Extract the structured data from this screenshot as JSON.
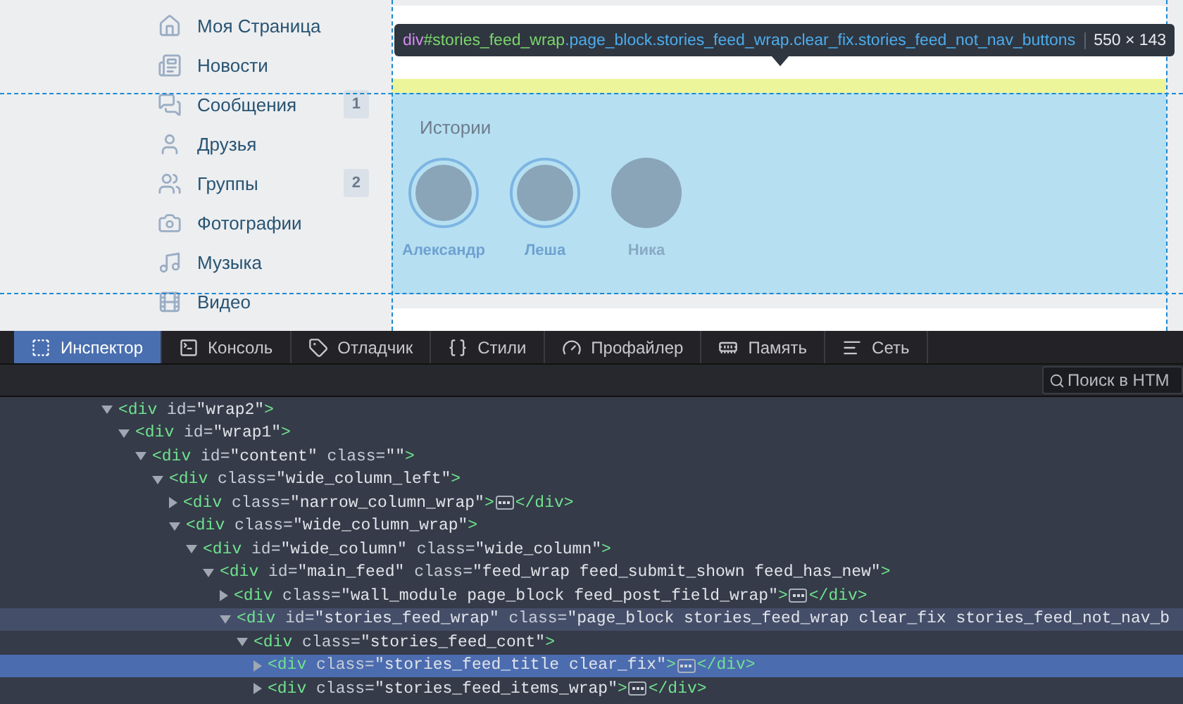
{
  "sidebar": {
    "items": [
      {
        "label": "Моя Страница"
      },
      {
        "label": "Новости"
      },
      {
        "label": "Сообщения",
        "counter": "1"
      },
      {
        "label": "Друзья"
      },
      {
        "label": "Группы",
        "counter": "2"
      },
      {
        "label": "Фотографии"
      },
      {
        "label": "Музыка"
      },
      {
        "label": "Видео"
      }
    ]
  },
  "tooltip": {
    "tag": "div",
    "id": "#stories_feed_wrap",
    "classes": ".page_block.stories_feed_wrap.clear_fix.stories_feed_not_nav_buttons",
    "size": "550 × 143"
  },
  "stories": {
    "title": "Истории",
    "items": [
      {
        "name": "Александр",
        "unread": true
      },
      {
        "name": "Леша",
        "unread": true
      },
      {
        "name": "Ника",
        "unread": false
      }
    ]
  },
  "devtools": {
    "tabs": [
      {
        "label": "Инспектор",
        "selected": true
      },
      {
        "label": "Консоль",
        "selected": false
      },
      {
        "label": "Отладчик",
        "selected": false
      },
      {
        "label": "Стили",
        "selected": false
      },
      {
        "label": "Профайлер",
        "selected": false
      },
      {
        "label": "Память",
        "selected": false
      },
      {
        "label": "Сеть",
        "selected": false
      }
    ],
    "search": {
      "placeholder": "Поиск в HTM"
    },
    "tree": [
      {
        "tag": "<div",
        "attrs": [
          {
            "name": "id=",
            "value": "\"wrap2\""
          }
        ],
        "end": ">",
        "expanded": true,
        "selected": false,
        "children": [
          {
            "tag": "<div",
            "attrs": [
              {
                "name": "id=",
                "value": "\"wrap1\""
              }
            ],
            "end": ">",
            "expanded": true,
            "selected": false,
            "children": [
              {
                "tag": "<div",
                "attrs": [
                  {
                    "name": "id=",
                    "value": "\"content\""
                  },
                  {
                    "name": "class=",
                    "value": "\"\""
                  }
                ],
                "end": ">",
                "expanded": true,
                "selected": false,
                "children": [
                  {
                    "tag": "<div",
                    "attrs": [
                      {
                        "name": "class=",
                        "value": "\"wide_column_left\""
                      }
                    ],
                    "end": ">",
                    "expanded": true,
                    "selected": false,
                    "children": [
                      {
                        "tag": "<div",
                        "attrs": [
                          {
                            "name": "class=",
                            "value": "\"narrow_column_wrap\""
                          }
                        ],
                        "end": ">",
                        "closing": "</div>",
                        "expanded": false,
                        "selected": false
                      },
                      {
                        "tag": "<div",
                        "attrs": [
                          {
                            "name": "class=",
                            "value": "\"wide_column_wrap\""
                          }
                        ],
                        "end": ">",
                        "expanded": true,
                        "selected": false,
                        "children": [
                          {
                            "tag": "<div",
                            "attrs": [
                              {
                                "name": "id=",
                                "value": "\"wide_column\""
                              },
                              {
                                "name": "class=",
                                "value": "\"wide_column\""
                              }
                            ],
                            "end": ">",
                            "expanded": true,
                            "selected": false,
                            "children": [
                              {
                                "tag": "<div",
                                "attrs": [
                                  {
                                    "name": "id=",
                                    "value": "\"main_feed\""
                                  },
                                  {
                                    "name": "class=",
                                    "value": "\"feed_wrap feed_submit_shown feed_has_new\""
                                  }
                                ],
                                "end": ">",
                                "expanded": true,
                                "selected": false,
                                "children": [
                                  {
                                    "tag": "<div",
                                    "attrs": [
                                      {
                                        "name": "class=",
                                        "value": "\"wall_module page_block feed_post_field_wrap\""
                                      }
                                    ],
                                    "end": ">",
                                    "closing": "</div>",
                                    "expanded": false,
                                    "selected": false
                                  },
                                  {
                                    "tag": "<div",
                                    "attrs": [
                                      {
                                        "name": "id=",
                                        "value": "\"stories_feed_wrap\""
                                      },
                                      {
                                        "name": "class=",
                                        "value": "\"page_block stories_feed_wrap clear_fix stories_feed_not_nav_b"
                                      }
                                    ],
                                    "expanded": true,
                                    "selected": false,
                                    "hovered": true,
                                    "children": [
                                      {
                                        "tag": "<div",
                                        "attrs": [
                                          {
                                            "name": "class=",
                                            "value": "\"stories_feed_cont\""
                                          }
                                        ],
                                        "end": ">",
                                        "expanded": true,
                                        "selected": false,
                                        "children": [
                                          {
                                            "tag": "<div",
                                            "attrs": [
                                              {
                                                "name": "class=",
                                                "value": "\"stories_feed_title clear_fix\""
                                              }
                                            ],
                                            "end": ">",
                                            "closing": "</div>",
                                            "expanded": false,
                                            "selected": true
                                          },
                                          {
                                            "tag": "<div",
                                            "attrs": [
                                              {
                                                "name": "class=",
                                                "value": "\"stories_feed_items_wrap\""
                                              }
                                            ],
                                            "end": ">",
                                            "closing": "</div>",
                                            "expanded": false,
                                            "selected": false
                                          }
                                        ]
                                      }
                                    ]
                                  }
                                ]
                              }
                            ]
                          }
                        ]
                      }
                    ]
                  }
                ]
              }
            ]
          }
        ]
      }
    ]
  }
}
